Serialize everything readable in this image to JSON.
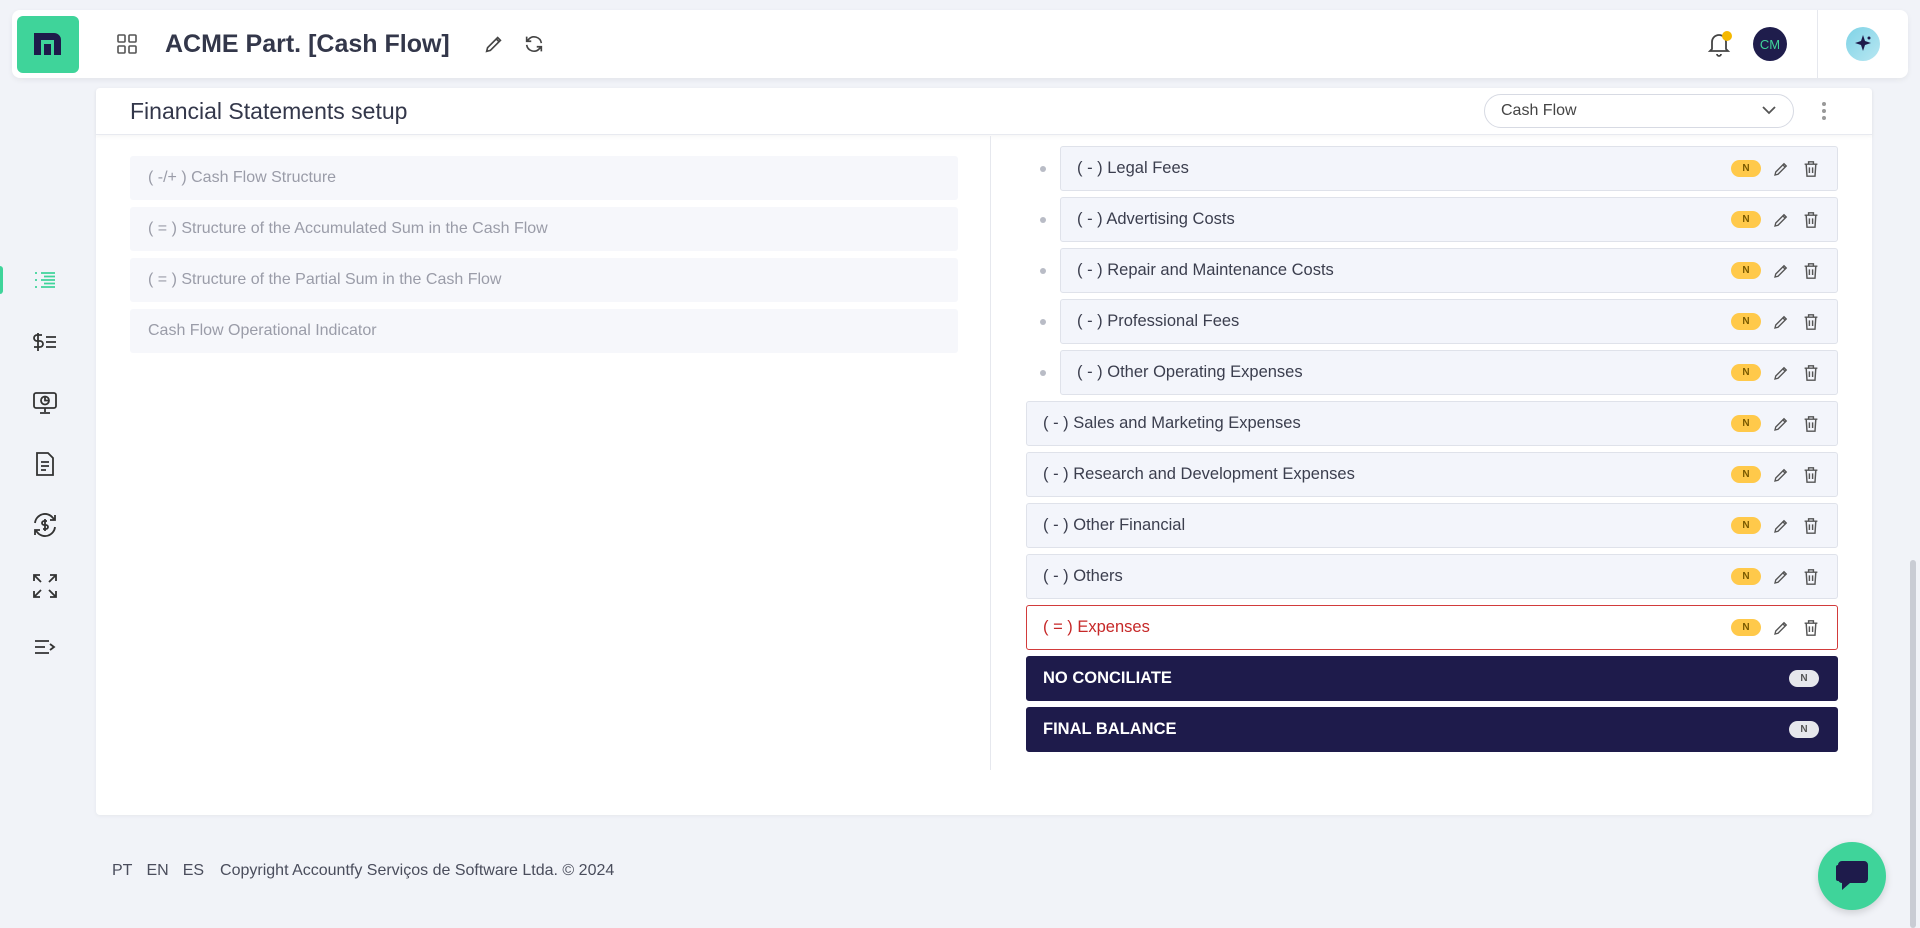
{
  "header": {
    "title": "ACME Part. [Cash Flow]",
    "avatar_initials": "CM"
  },
  "page": {
    "title": "Financial Statements setup",
    "selected_statement": "Cash Flow"
  },
  "left_items": [
    "( -/+ ) Cash Flow Structure",
    "( = ) Structure of the Accumulated Sum in the Cash Flow",
    "( = ) Structure of the Partial Sum in the Cash Flow",
    "Cash Flow Operational Indicator"
  ],
  "rows": [
    {
      "label": "( - ) Legal Fees",
      "badge": "N",
      "variant": "nested"
    },
    {
      "label": "( - ) Advertising Costs",
      "badge": "N",
      "variant": "nested"
    },
    {
      "label": "( - ) Repair and Maintenance Costs",
      "badge": "N",
      "variant": "nested"
    },
    {
      "label": "( - ) Professional Fees",
      "badge": "N",
      "variant": "nested"
    },
    {
      "label": "( - ) Other Operating Expenses",
      "badge": "N",
      "variant": "nested"
    },
    {
      "label": "( - ) Sales and Marketing Expenses",
      "badge": "N",
      "variant": "top"
    },
    {
      "label": "( - ) Research and Development Expenses",
      "badge": "N",
      "variant": "top"
    },
    {
      "label": "( - ) Other Financial",
      "badge": "N",
      "variant": "top"
    },
    {
      "label": "( - ) Others",
      "badge": "N",
      "variant": "top"
    },
    {
      "label": "( = ) Expenses",
      "badge": "N",
      "variant": "expense"
    },
    {
      "label": "NO CONCILIATE",
      "badge": "N",
      "variant": "dark"
    },
    {
      "label": "FINAL BALANCE",
      "badge": "N",
      "variant": "dark"
    }
  ],
  "footer": {
    "langs": [
      "PT",
      "EN",
      "ES"
    ],
    "copyright": "Copyright Accountfy Serviços de Software Ltda. © 2024"
  },
  "colors": {
    "brand": "#3fd49a",
    "dark": "#1e1b4b",
    "badge": "#ffc94a",
    "expense": "#c62828"
  }
}
